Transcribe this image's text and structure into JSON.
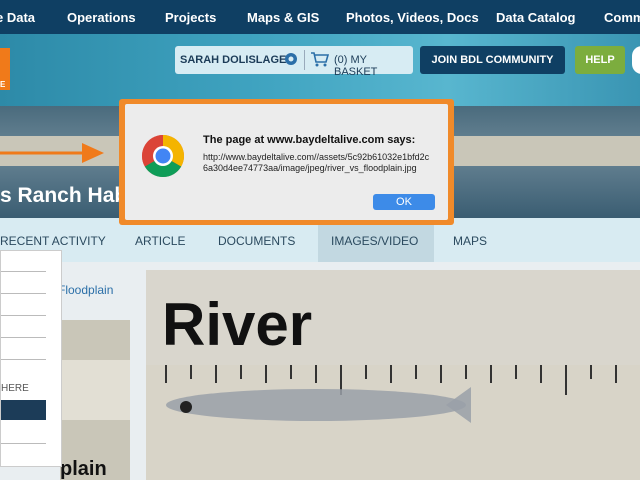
{
  "top_nav": {
    "items": [
      "e Data",
      "Operations",
      "Projects",
      "Maps & GIS",
      "Photos, Videos, Docs",
      "Data Catalog",
      "Comm"
    ]
  },
  "header": {
    "logo_text": "E",
    "user_name": "SARAH DOLISLAGER",
    "basket_label": "(0) MY BASKET",
    "join_label": "JOIN BDL COMMUNITY",
    "help_label": "HELP"
  },
  "banner": {
    "title": "s Ranch Hab"
  },
  "tabs": [
    "RECENT ACTIVITY",
    "ARTICLE",
    "DOCUMENTS",
    "IMAGES/VIDEO",
    "MAPS"
  ],
  "sidebar": {
    "link_text": "Floodplain",
    "dropdown_item": "HERE",
    "thumb_text": "plain"
  },
  "photo": {
    "big_text": "River"
  },
  "dialog": {
    "heading": "The page at www.baydeltalive.com says:",
    "message": "http://www.baydeltalive.com//assets/5c92b61032e1bfd2c6a30d4ee74773aa/image/jpeg/river_vs_floodplain.jpg",
    "ok_label": "OK"
  },
  "colors": {
    "nav": "#0f3f63",
    "accent_orange": "#f07a1a",
    "help_green": "#7cad3e",
    "ok_blue": "#3d8be8"
  }
}
